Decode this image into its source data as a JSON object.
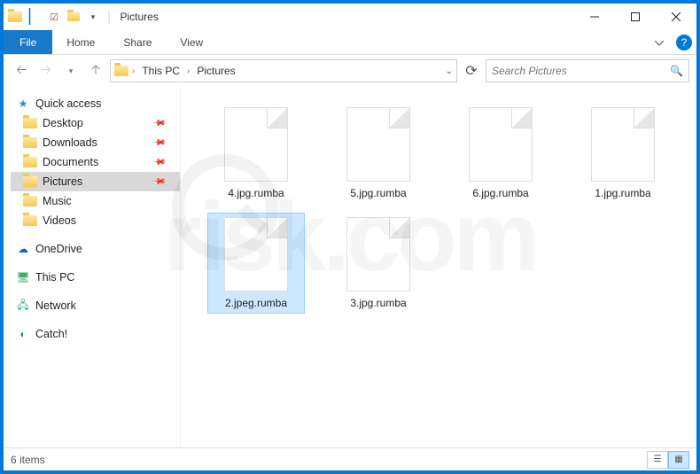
{
  "titlebar": {
    "title": "Pictures"
  },
  "ribbon": {
    "file": "File",
    "tabs": [
      "Home",
      "Share",
      "View"
    ]
  },
  "breadcrumb": {
    "items": [
      "This PC",
      "Pictures"
    ]
  },
  "search": {
    "placeholder": "Search Pictures"
  },
  "sidebar": {
    "quick_access": {
      "label": "Quick access",
      "items": [
        {
          "label": "Desktop",
          "pinned": true
        },
        {
          "label": "Downloads",
          "pinned": true
        },
        {
          "label": "Documents",
          "pinned": true
        },
        {
          "label": "Pictures",
          "pinned": true,
          "selected": true
        },
        {
          "label": "Music",
          "pinned": false
        },
        {
          "label": "Videos",
          "pinned": false
        }
      ]
    },
    "onedrive": {
      "label": "OneDrive"
    },
    "this_pc": {
      "label": "This PC"
    },
    "network": {
      "label": "Network"
    },
    "catch": {
      "label": "Catch!"
    }
  },
  "files": [
    {
      "name": "4.jpg.rumba",
      "selected": false
    },
    {
      "name": "5.jpg.rumba",
      "selected": false
    },
    {
      "name": "6.jpg.rumba",
      "selected": false
    },
    {
      "name": "1.jpg.rumba",
      "selected": false
    },
    {
      "name": "2.jpeg.rumba",
      "selected": true
    },
    {
      "name": "3.jpg.rumba",
      "selected": false
    }
  ],
  "status": {
    "text": "6 items"
  },
  "watermark": {
    "text": "risk.com"
  }
}
